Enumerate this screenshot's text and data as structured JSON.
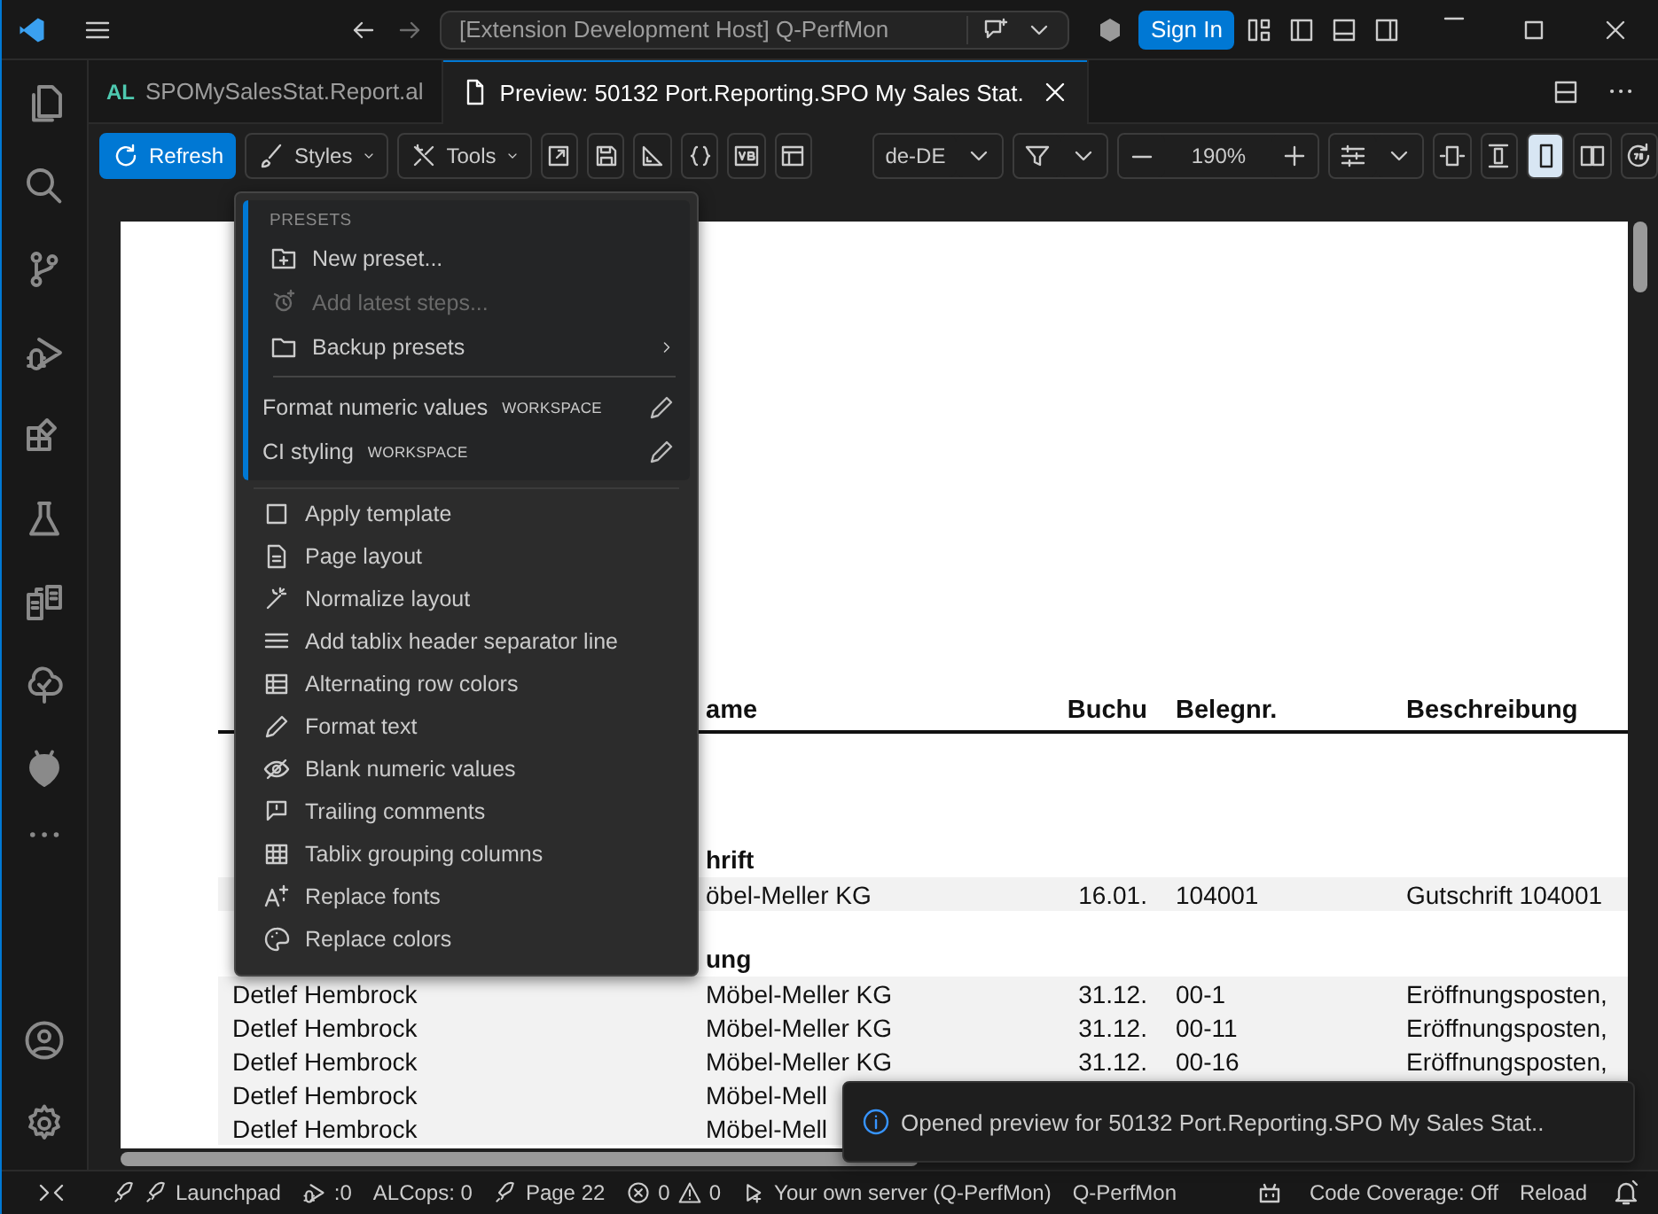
{
  "title_bar": {
    "command_center": "[Extension Development Host] Q-PerfMon",
    "sign_in": "Sign In"
  },
  "tabs": [
    {
      "badge": "AL",
      "label": "SPOMySalesStat.Report.al",
      "selected": false
    },
    {
      "label": "Preview: 50132 Port.Reporting.SPO My Sales Stat.",
      "selected": true
    }
  ],
  "toolbar": {
    "refresh": "Refresh",
    "styles": "Styles",
    "tools": "Tools",
    "locale": "de-DE",
    "zoom": "190%"
  },
  "page_views": [
    {
      "selected": true
    },
    {
      "selected": false
    }
  ],
  "styles_menu": {
    "section": "PRESETS",
    "preset_actions": [
      {
        "label": "New preset...",
        "disabled": false,
        "submenu": false
      },
      {
        "label": "Add latest steps...",
        "disabled": true,
        "submenu": false
      },
      {
        "label": "Backup presets",
        "disabled": false,
        "submenu": true
      }
    ],
    "presets": [
      {
        "label": "Format numeric values",
        "scope": "WORKSPACE"
      },
      {
        "label": "CI styling",
        "scope": "WORKSPACE"
      }
    ],
    "items": [
      "Apply template",
      "Page layout",
      "Normalize layout",
      "Add tablix header separator line",
      "Alternating row colors",
      "Format text",
      "Blank numeric values",
      "Trailing comments",
      "Tablix grouping columns",
      "Replace fonts",
      "Replace colors"
    ]
  },
  "report": {
    "columns": [
      "ame",
      "Buchu",
      "Belegnr.",
      "Beschreibung"
    ],
    "rows": [
      {
        "kind": "group",
        "label": "hrift"
      },
      {
        "kind": "line",
        "column_2": "öbel-Meller KG",
        "column_3": "16.01.",
        "column_4": "104001",
        "column_5": "Gutschrift 104001"
      },
      {
        "kind": "group",
        "label": "ung"
      },
      {
        "kind": "line",
        "column_1": "Detlef Hembrock",
        "column_2": "Möbel-Meller KG",
        "column_3": "31.12.",
        "column_4": "00-1",
        "column_5": "Eröffnungsposten,"
      },
      {
        "kind": "line",
        "column_1": "Detlef Hembrock",
        "column_2": "Möbel-Meller KG",
        "column_3": "31.12.",
        "column_4": "00-11",
        "column_5": "Eröffnungsposten,"
      },
      {
        "kind": "line",
        "column_1": "Detlef Hembrock",
        "column_2": "Möbel-Meller KG",
        "column_3": "31.12.",
        "column_4": "00-16",
        "column_5": "Eröffnungsposten,"
      },
      {
        "kind": "line",
        "column_1": "Detlef Hembrock",
        "column_2": "Möbel-Mell"
      },
      {
        "kind": "line",
        "column_1": "Detlef Hembrock",
        "column_2": "Möbel-Mell"
      }
    ]
  },
  "notification": "Opened preview for 50132 Port.Reporting.SPO My Sales Stat..",
  "status_bar": {
    "launchpad": "Launchpad",
    "debug": ":0",
    "alcops": "ALCops: 0",
    "page": "Page 22",
    "errors": "0",
    "warnings": "0",
    "server": "Your own server (Q-PerfMon)",
    "project": "Q-PerfMon",
    "coverage": "Code Coverage: Off",
    "reload": "Reload"
  }
}
